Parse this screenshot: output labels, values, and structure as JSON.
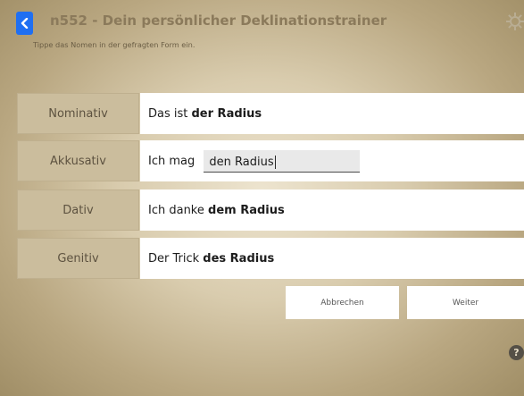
{
  "header": {
    "title": "n552 - Dein persönlicher Deklinationstrainer",
    "subtitle": "Tippe das Nomen in der gefragten Form ein.",
    "back_icon": "chevron-left-icon",
    "settings_icon": "gear-icon",
    "accent_color": "#1f6ff2"
  },
  "rows": [
    {
      "case": "Nominativ",
      "prefix": "Das ist ",
      "answer": "der Radius"
    },
    {
      "case": "Akkusativ",
      "prefix": "Ich mag ",
      "input_value": "den Radius"
    },
    {
      "case": "Dativ",
      "prefix": "Ich danke ",
      "answer": "dem Radius"
    },
    {
      "case": "Genitiv",
      "prefix": "Der Trick ",
      "answer": "des Radius"
    }
  ],
  "buttons": {
    "cancel": "Abbrechen",
    "next": "Weiter"
  },
  "help": {
    "label": "?",
    "icon": "help-icon"
  }
}
